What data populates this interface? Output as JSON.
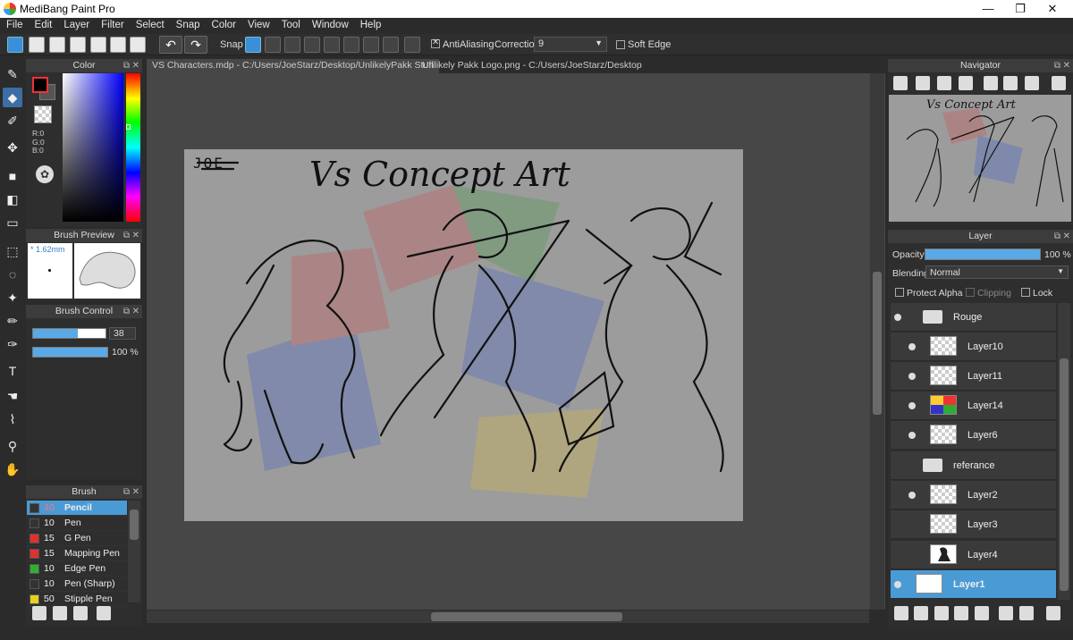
{
  "window": {
    "title": "MediBang Paint Pro",
    "minimize": "—",
    "maximize": "❐",
    "close": "✕"
  },
  "menu": [
    "File",
    "Edit",
    "Layer",
    "Filter",
    "Select",
    "Snap",
    "Color",
    "View",
    "Tool",
    "Window",
    "Help"
  ],
  "toolbar": {
    "snap_label": "Snap",
    "antialiasing_label": "AntiAliasing",
    "correction_label": "Correction",
    "correction_value": "9",
    "soft_edge_label": "Soft Edge",
    "undo": "↶",
    "redo": "↷"
  },
  "tabs": [
    {
      "label": "VS Characters.mdp - C:/Users/JoeStarz/Desktop/UnlikelyPakk Stuff"
    },
    {
      "label": "Unlikely Pakk Logo.png - C:/Users/JoeStarz/Desktop"
    }
  ],
  "color_panel": {
    "title": "Color",
    "r": "R:0",
    "g": "G:0",
    "b": "B:0",
    "primary": "#000000",
    "secondary": "#333333"
  },
  "brush_preview": {
    "title": "Brush Preview",
    "size": "1.62mm"
  },
  "brush_control": {
    "title": "Brush Control",
    "size_value": "38",
    "opacity_value": "100 %"
  },
  "brush_panel": {
    "title": "Brush",
    "items": [
      {
        "size": "40",
        "name": "Pencil",
        "color": "#333333"
      },
      {
        "size": "10",
        "name": "Pen",
        "color": "#333333"
      },
      {
        "size": "15",
        "name": "G Pen",
        "color": "#e03030"
      },
      {
        "size": "15",
        "name": "Mapping Pen",
        "color": "#e03030"
      },
      {
        "size": "10",
        "name": "Edge Pen",
        "color": "#30b030"
      },
      {
        "size": "10",
        "name": "Pen (Sharp)",
        "color": "#333333"
      },
      {
        "size": "50",
        "name": "Stipple Pen",
        "color": "#e8d020"
      }
    ]
  },
  "artwork": {
    "signature": "JOE",
    "heading": "Vs Concept Art"
  },
  "navigator": {
    "title": "Navigator",
    "heading": "Vs Concept Art"
  },
  "layer_panel": {
    "title": "Layer",
    "opacity_label": "Opacity",
    "opacity_value": "100 %",
    "opacity_fraction": 1.0,
    "blending_label": "Blending",
    "blending_value": "Normal",
    "protect_alpha": "Protect Alpha",
    "clipping": "Clipping",
    "lock": "Lock",
    "layers": [
      {
        "name": "Rouge",
        "type": "folder",
        "visible": true
      },
      {
        "name": "Layer10",
        "type": "layer",
        "visible": true
      },
      {
        "name": "Layer11",
        "type": "layer",
        "visible": true
      },
      {
        "name": "Layer14",
        "type": "layer",
        "visible": true
      },
      {
        "name": "Layer6",
        "type": "layer",
        "visible": true
      },
      {
        "name": "referance",
        "type": "folder",
        "visible": false
      },
      {
        "name": "Layer2",
        "type": "layer",
        "visible": true
      },
      {
        "name": "Layer3",
        "type": "layer",
        "visible": false
      },
      {
        "name": "Layer4",
        "type": "layer",
        "visible": false
      },
      {
        "name": "Layer1",
        "type": "layer",
        "visible": true,
        "selected": true
      }
    ]
  },
  "colors": {
    "accent": "#4a9ad6",
    "canvas_bg": "#474747",
    "paper": "#9c9c9c"
  }
}
